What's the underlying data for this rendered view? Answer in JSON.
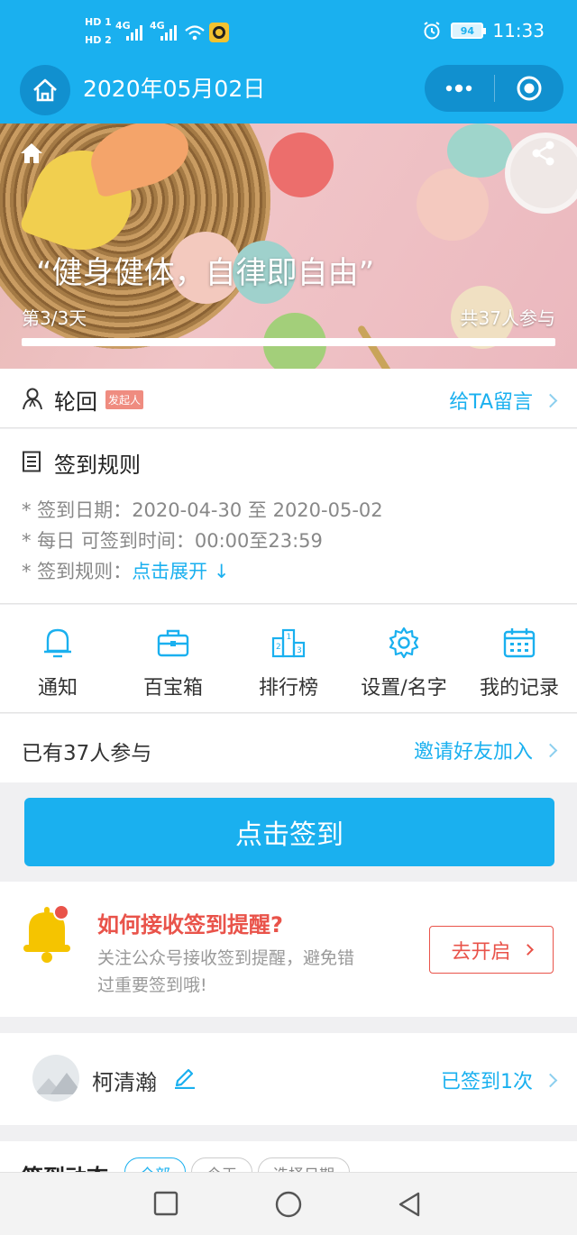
{
  "status_bar": {
    "time": "11:33",
    "battery": "94",
    "sim1": "HD 1",
    "sim2": "HD 2",
    "network": "4G"
  },
  "nav": {
    "title": "2020年05月02日",
    "home_icon": "home-icon",
    "more_icon": "more-dots-icon",
    "close_icon": "target-circle-icon"
  },
  "banner": {
    "quote": "“健身健体，自律即自由”",
    "day_progress": "第3/3天",
    "participants": "共37人参与",
    "progress_fraction": 1.0
  },
  "organizer": {
    "name": "轮回",
    "badge": "发起人",
    "message_link": "给TA留言"
  },
  "rules": {
    "title": "签到规则",
    "date_label": "* 签到日期：",
    "date_value": "2020-04-30 至 2020-05-02",
    "time_label": "* 每日 可签到时间：",
    "time_value": "00:00至23:59",
    "rule_label": "* 签到规则：",
    "rule_link": "点击展开 ↓"
  },
  "menu": {
    "items": [
      {
        "label": "通知",
        "icon": "bell-icon"
      },
      {
        "label": "百宝箱",
        "icon": "toolbox-icon"
      },
      {
        "label": "排行榜",
        "icon": "podium-icon"
      },
      {
        "label": "设置/名字",
        "icon": "gear-icon"
      },
      {
        "label": "我的记录",
        "icon": "calendar-icon"
      }
    ]
  },
  "participants": {
    "text": "已有37人参与",
    "invite_link": "邀请好友加入"
  },
  "checkin": {
    "button": "点击签到"
  },
  "reminder": {
    "title": "如何接收签到提醒?",
    "description": "关注公众号接收签到提醒，避免错过重要签到哦!",
    "button": "去开启"
  },
  "user": {
    "name": "柯清瀚",
    "status": "已签到1次"
  },
  "feed": {
    "title": "签到动态",
    "chips": [
      "全部",
      "今天",
      "选择日期"
    ]
  },
  "colors": {
    "primary": "#1ab0ef",
    "primary_dark": "#1190cf",
    "alert": "#e9534a",
    "badge": "#ef8c80"
  }
}
